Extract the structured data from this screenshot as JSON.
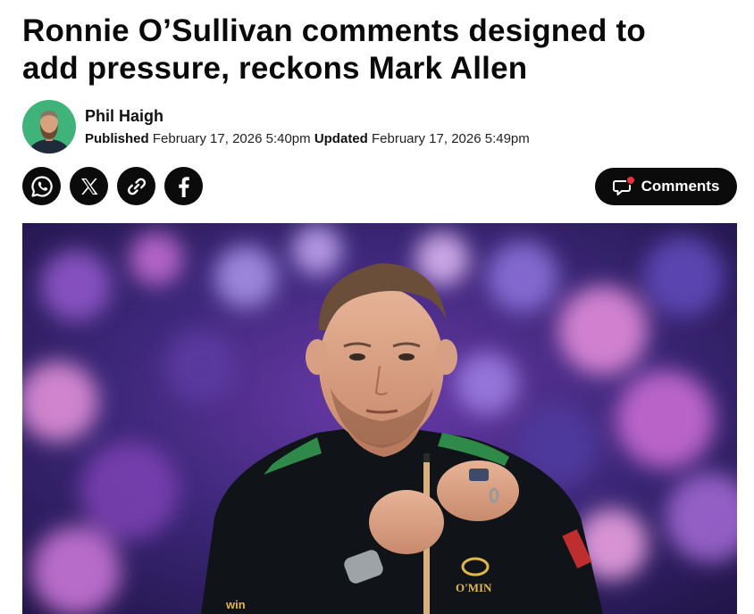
{
  "article": {
    "headline_line1": "Ronnie O’Sullivan comments designed to",
    "headline_line2": "add pressure, reckons Mark Allen"
  },
  "byline": {
    "author": "Phil Haigh",
    "published_label": "Published",
    "published_date": "February 17, 2026 5:40pm",
    "updated_label": "Updated",
    "updated_date": "February 17, 2026 5:49pm",
    "avatar_bg_color": "#3fb37a"
  },
  "share": {
    "buttons": [
      {
        "icon": "whatsapp-icon"
      },
      {
        "icon": "x-icon"
      },
      {
        "icon": "link-icon"
      },
      {
        "icon": "facebook-icon"
      }
    ]
  },
  "comments": {
    "label": "Comments",
    "icon": "comment-bubble-icon",
    "notification_dot_color": "#e5323d"
  },
  "hero_image": {
    "subject": "snooker player chalking cue",
    "shirt_logo_text": "O'MIN",
    "sponsor_text": "win",
    "background_tones": [
      "#3b2a7a",
      "#7a3fa8",
      "#d98fd0"
    ]
  }
}
